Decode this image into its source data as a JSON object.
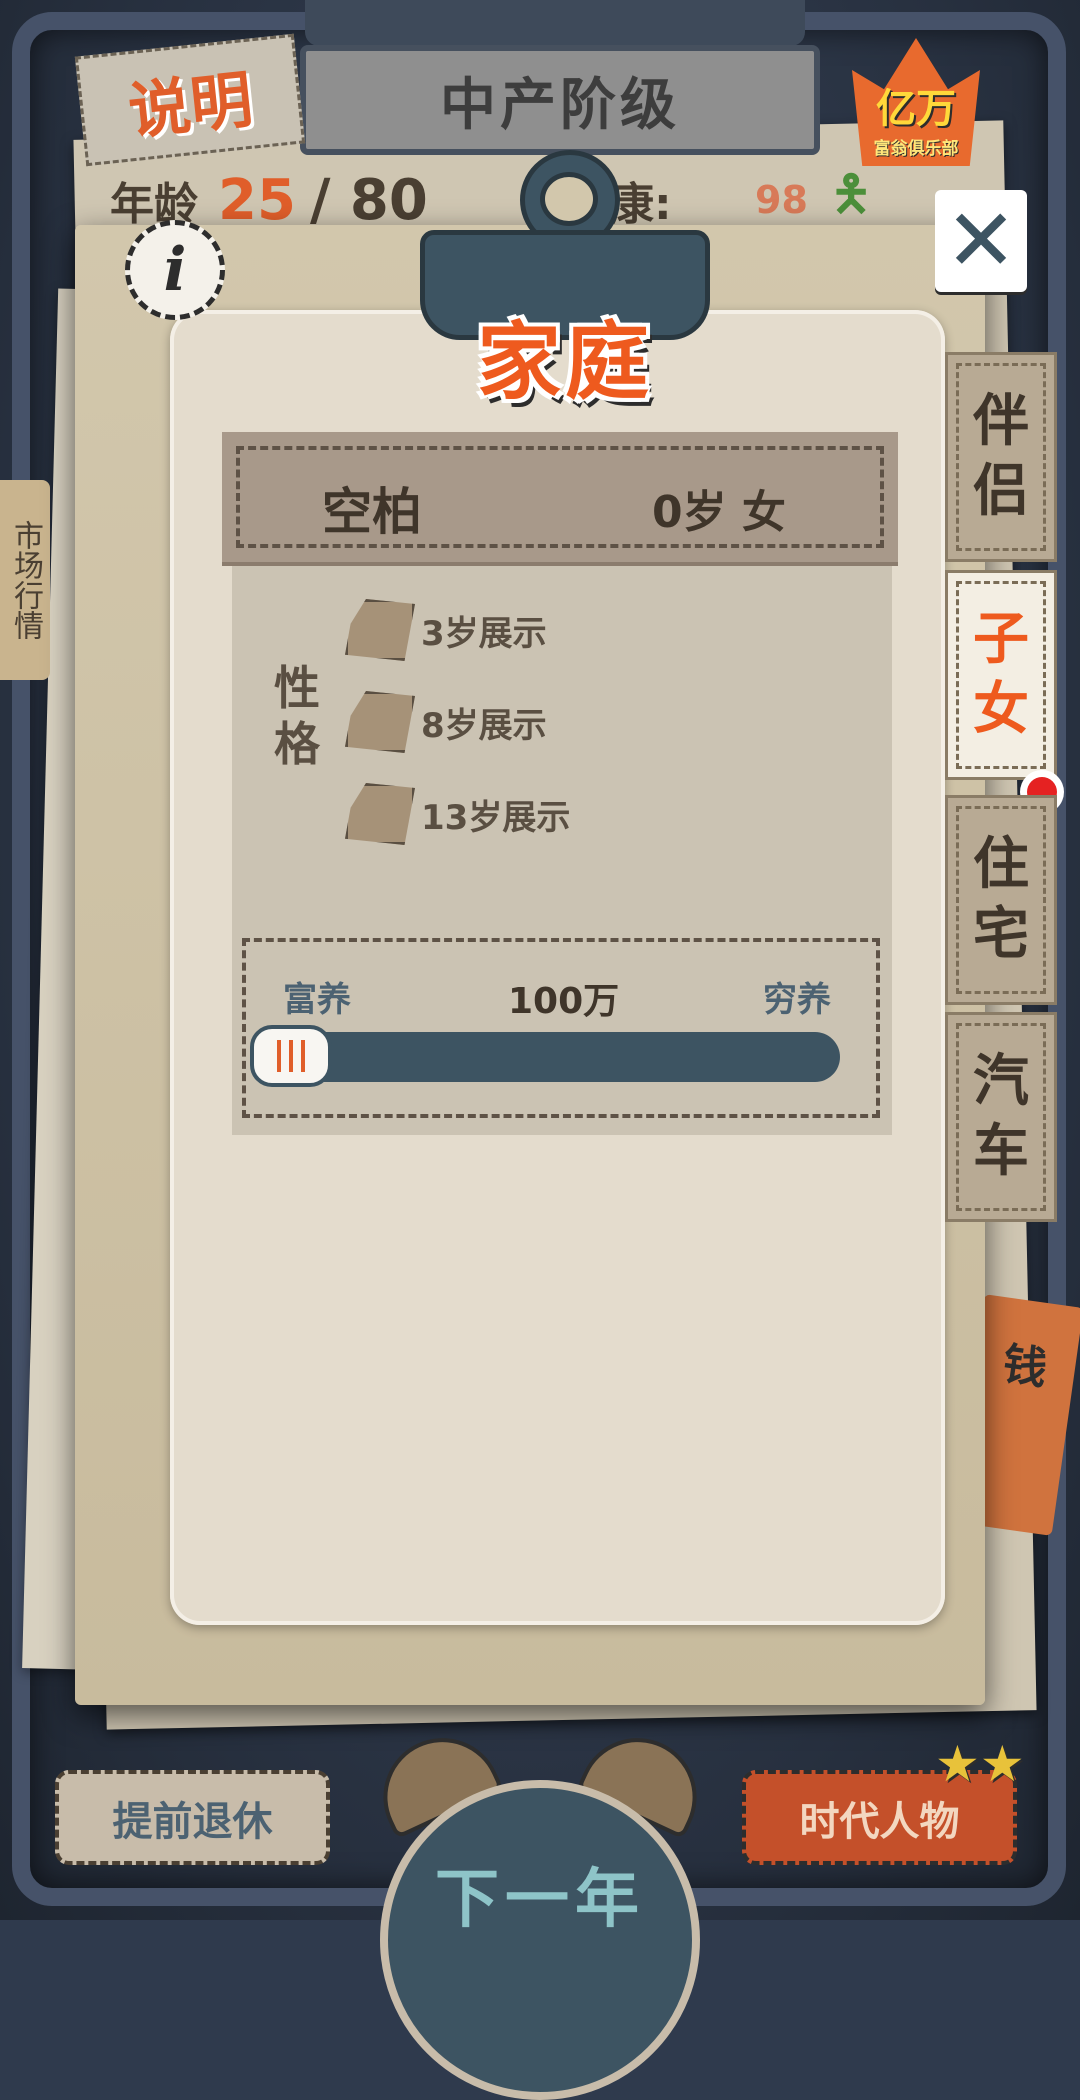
{
  "header": {
    "class_title": "中产阶级",
    "help_label": "说明",
    "club_badge": {
      "main": "亿万",
      "sub": "富翁俱乐部"
    }
  },
  "stats": {
    "age_label": "年龄",
    "age_value": "25",
    "age_max": "/ 80",
    "health_label": "康:",
    "health_value": "98"
  },
  "side_strip_text": "市场行情",
  "ticket": {
    "text": "钱"
  },
  "dialog": {
    "title": "家庭",
    "info_icon": "info-icon",
    "close_icon": "close-icon"
  },
  "child": {
    "name": "空柏",
    "age_gender": "0岁 女"
  },
  "traits": {
    "label": "性格",
    "items": [
      {
        "text": "3岁展示"
      },
      {
        "text": "8岁展示"
      },
      {
        "text": "13岁展示"
      }
    ]
  },
  "upbringing": {
    "left_label": "富养",
    "value": "100万",
    "right_label": "穷养",
    "level_fraction": 0.0
  },
  "tabs": [
    {
      "label": "伴侣",
      "active": false
    },
    {
      "label": "子女",
      "active": true
    },
    {
      "label": "住宅",
      "active": false
    },
    {
      "label": "汽车",
      "active": false
    }
  ],
  "bottom": {
    "retire_label": "提前退休",
    "next_year_label": "下一年",
    "figures_label": "时代人物"
  },
  "colors": {
    "accent_orange": "#ee5a1e",
    "slate": "#3d5462",
    "paper": "#e4dccd"
  }
}
